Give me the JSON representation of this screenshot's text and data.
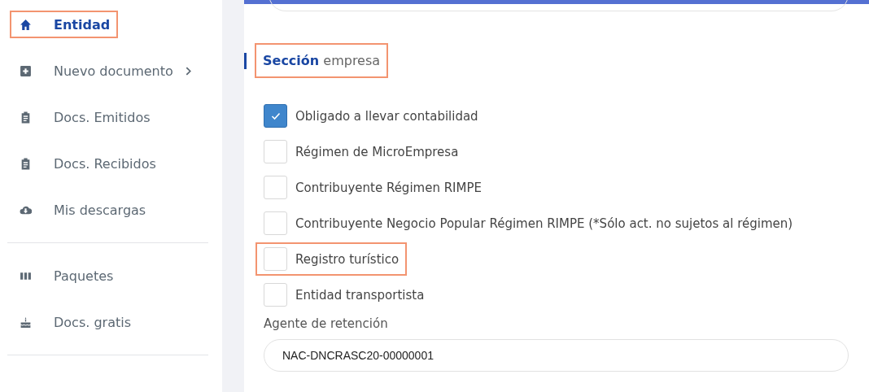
{
  "sidebar": {
    "groups": [
      {
        "items": [
          {
            "label": "Entidad",
            "kind": "home",
            "selected": true,
            "highlighted": true,
            "submenu": false
          },
          {
            "label": "Nuevo documento",
            "kind": "plus",
            "selected": false,
            "highlighted": false,
            "submenu": true
          },
          {
            "label": "Docs. Emitidos",
            "kind": "clipboard",
            "selected": false,
            "highlighted": false,
            "submenu": false
          },
          {
            "label": "Docs. Recibidos",
            "kind": "clipboard",
            "selected": false,
            "highlighted": false,
            "submenu": false
          },
          {
            "label": "Mis descargas",
            "kind": "cloud",
            "selected": false,
            "highlighted": false,
            "submenu": false
          }
        ]
      },
      {
        "items": [
          {
            "label": "Paquetes",
            "kind": "bars",
            "selected": false,
            "highlighted": false,
            "submenu": false
          },
          {
            "label": "Docs. gratis",
            "kind": "cake",
            "selected": false,
            "highlighted": false,
            "submenu": false
          }
        ]
      }
    ]
  },
  "section": {
    "title": "**Sección** empresa",
    "highlighted": true,
    "options": [
      {
        "label": "Obligado a llevar contabilidad",
        "checked": true,
        "highlighted": false
      },
      {
        "label": "Régimen de MicroEmpresa",
        "checked": false,
        "highlighted": false
      },
      {
        "label": "Contribuyente Régimen RIMPE",
        "checked": false,
        "highlighted": false
      },
      {
        "label": "Contribuyente Negocio Popular Régimen RIMPE (*Sólo act. no sujetos al régimen)",
        "checked": false,
        "highlighted": false
      },
      {
        "label": "Registro turístico",
        "checked": false,
        "highlighted": true
      },
      {
        "label": "Entidad transportista",
        "checked": false,
        "highlighted": false
      }
    ],
    "field": {
      "label": "Agente de retención",
      "value": "NAC-DNCRASC20-00000001"
    }
  }
}
